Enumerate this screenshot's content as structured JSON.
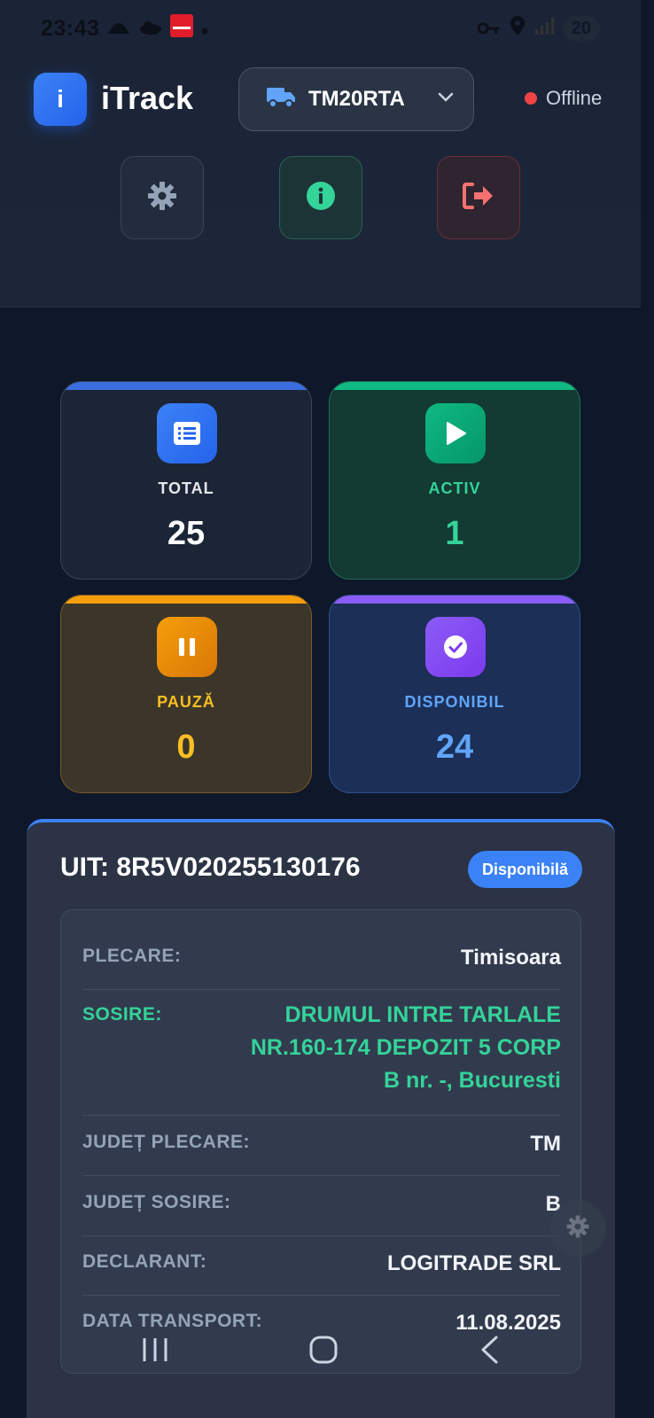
{
  "statusbar": {
    "time": "23:43",
    "battery": "20"
  },
  "header": {
    "logo_letter": "i",
    "app_title": "iTrack",
    "vehicle_plate": "TM20RTA",
    "connection_status": "Offline"
  },
  "stats": {
    "total": {
      "label": "TOTAL",
      "value": "25"
    },
    "activ": {
      "label": "ACTIV",
      "value": "1"
    },
    "pauza": {
      "label": "PAUZĂ",
      "value": "0"
    },
    "disponibil": {
      "label": "DISPONIBIL",
      "value": "24"
    }
  },
  "transport": {
    "uit": "UIT: 8R5V020255130176",
    "status_badge": "Disponibilă",
    "fields": {
      "plecare_label": "PLECARE:",
      "plecare_value": "Timisoara",
      "sosire_label": "SOSIRE:",
      "sosire_value": "DRUMUL INTRE TARLALE NR.160-174 DEPOZIT 5 CORP B nr. -, Bucuresti",
      "judet_plecare_label": "JUDEȚ PLECARE:",
      "judet_plecare_value": "TM",
      "judet_sosire_label": "JUDEȚ SOSIRE:",
      "judet_sosire_value": "B",
      "declarant_label": "DECLARANT:",
      "declarant_value": "LOGITRADE SRL",
      "data_transport_label": "DATA TRANSPORT:",
      "data_transport_value": "11.08.2025"
    }
  },
  "colors": {
    "accent_blue": "#3b82f6",
    "green": "#10b981",
    "amber": "#f59e0b",
    "purple": "#8b5cf6",
    "offline_red": "#ef4444"
  },
  "icons": {
    "vehicle": "truck-icon",
    "settings": "gear-icon",
    "info": "info-icon",
    "logout": "logout-icon",
    "total": "list-icon",
    "activ": "play-icon",
    "pauza": "pause-icon",
    "disponibil": "check-circle-icon"
  }
}
